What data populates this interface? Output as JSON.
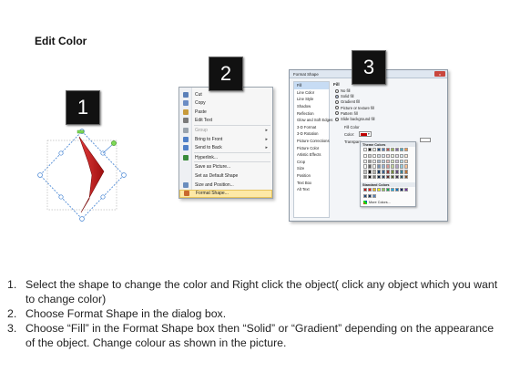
{
  "title": "Edit Color",
  "badges": [
    "1",
    "2",
    "3"
  ],
  "context_menu": {
    "items": [
      {
        "label": "Cut",
        "underline": "t",
        "icon": "scissors-icon",
        "color": "#5a7fb8"
      },
      {
        "label": "Copy",
        "icon": "copy-icon",
        "color": "#6b8cc4"
      },
      {
        "label": "Paste",
        "icon": "paste-icon",
        "color": "#c89b3c"
      },
      {
        "label": "Edit Text",
        "icon": "edit-text-icon",
        "color": "#7a7a7a"
      },
      {
        "label": "Group",
        "icon": "group-icon",
        "color": "#9aa3ad",
        "disabled": true,
        "submenu": true
      },
      {
        "label": "Bring to Front",
        "icon": "bring-front-icon",
        "color": "#4f7fc7",
        "submenu": true
      },
      {
        "label": "Send to Back",
        "icon": "send-back-icon",
        "color": "#4f7fc7",
        "submenu": true
      },
      {
        "label": "Hyperlink...",
        "icon": "hyperlink-icon",
        "color": "#3a8c3a"
      },
      {
        "label": "Save as Picture...",
        "icon": "",
        "color": ""
      },
      {
        "label": "Set as Default Shape",
        "icon": "",
        "color": ""
      },
      {
        "label": "Size and Position...",
        "icon": "size-icon",
        "color": "#6a8dbd"
      },
      {
        "label": "Format Shape...",
        "icon": "format-icon",
        "color": "#c96a2f",
        "highlight": true
      }
    ]
  },
  "format_dialog": {
    "title": "Format Shape",
    "close": "x",
    "categories": [
      "Fill",
      "Line Color",
      "Line Style",
      "Shadow",
      "Reflection",
      "Glow and Soft Edges",
      "3-D Format",
      "3-D Rotation",
      "Picture Corrections",
      "Picture Color",
      "Artistic Effects",
      "Crop",
      "Size",
      "Position",
      "Text Box",
      "Alt Text"
    ],
    "selected_category": "Fill",
    "fill_title": "Fill",
    "fill_options": [
      "No fill",
      "Solid fill",
      "Gradient fill",
      "Picture or texture fill",
      "Pattern fill",
      "Slide background fill"
    ],
    "selected_fill": "Solid fill",
    "fill_color_label": "Fill Color",
    "color_label": "Color:",
    "transparency_label": "Transpare"
  },
  "palette": {
    "theme_title": "Theme Colors",
    "standard_title": "Standard Colors",
    "more_colors": "More Colors...",
    "theme_top": [
      "#ffffff",
      "#000000",
      "#eeece1",
      "#1f497d",
      "#4f81bd",
      "#c0504d",
      "#9bbb59",
      "#8064a2",
      "#4bacc6",
      "#f79646"
    ],
    "standard": [
      "#c00000",
      "#ff0000",
      "#ffc000",
      "#ffff00",
      "#92d050",
      "#00b050",
      "#00b0f0",
      "#0070c0",
      "#002060",
      "#7030a0"
    ],
    "recent": [
      "#1f497d",
      "#17375e",
      "#4f81bd"
    ]
  },
  "instructions": [
    {
      "n": "1.",
      "text": "Select the shape to change the color and Right click the object( click any object which you want to change color)"
    },
    {
      "n": "2.",
      "text": "Choose Format Shape in the dialog box."
    },
    {
      "n": "3.",
      "text": "Choose “Fill” in the Format Shape box then “Solid” or “Gradient” depending on the appearance of the object. Change colour as shown in the picture."
    }
  ],
  "colors": {
    "arrow_red": "#c41e1e",
    "selection_blue": "#3d7fd1",
    "handle_green": "#7ed957"
  }
}
